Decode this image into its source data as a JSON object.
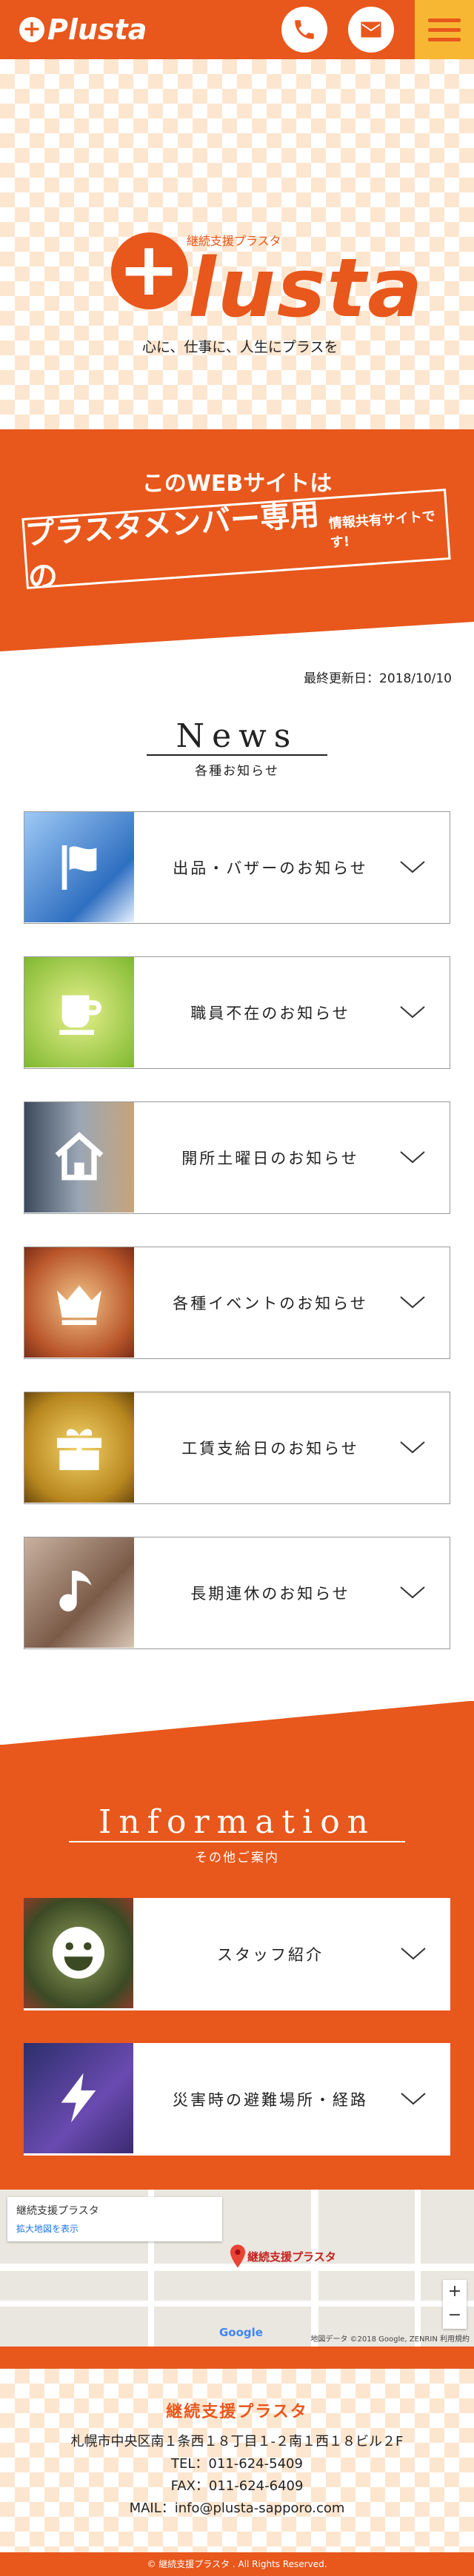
{
  "header": {
    "logo": "Plusta",
    "icons": [
      "phone-icon",
      "mail-icon",
      "menu-icon"
    ]
  },
  "hero": {
    "subtitle": "継続支援プラスタ",
    "wordmark": "lusta",
    "tagline": "心に、仕事に、人生にプラスを"
  },
  "banner": {
    "top": "このWEBサイトは",
    "main": "プラスタメンバー専用の",
    "small": "情報共有サイトです!"
  },
  "updated": "最終更新日：2018/10/10",
  "news": {
    "title": "News",
    "subtitle": "各種お知らせ",
    "items": [
      {
        "label": "出品・バザーのお知らせ",
        "icon": "flag-icon",
        "color": "#4a90d9"
      },
      {
        "label": "職員不在のお知らせ",
        "icon": "mug-icon",
        "color": "#9bc53d"
      },
      {
        "label": "開所土曜日のお知らせ",
        "icon": "house-icon",
        "color": "#6a7a8c"
      },
      {
        "label": "各種イベントのお知らせ",
        "icon": "crown-icon",
        "color": "#d9824a"
      },
      {
        "label": "工賃支給日のお知らせ",
        "icon": "gift-icon",
        "color": "#c9a227"
      },
      {
        "label": "長期連休のお知らせ",
        "icon": "music-note-icon",
        "color": "#8a6d5a"
      }
    ]
  },
  "information": {
    "title": "Information",
    "subtitle": "その他ご案内",
    "items": [
      {
        "label": "スタッフ紹介",
        "icon": "smile-icon",
        "color": "#5a6b3a"
      },
      {
        "label": "災害時の避難場所・経路",
        "icon": "lightning-icon",
        "color": "#4b3a8c"
      }
    ]
  },
  "map": {
    "place": "継続支援プラスタ",
    "link": "拡大地図を表示",
    "pin_label": "継続支援プラスタ",
    "footer": "地図データ ©2018 Google, ZENRIN 利用規約",
    "brand": "Google",
    "zoom_in": "+",
    "zoom_out": "−"
  },
  "footer": {
    "name": "継続支援プラスタ",
    "address": "札幌市中央区南１条西１８丁目１-２南１西１８ビル２F",
    "tel": "TEL：011-624-5409",
    "fax": "FAX：011-624-6409",
    "mail": "MAIL：info@plusta-sapporo.com",
    "copyright": "© 継続支援プラスタ . All Rights Reserved."
  }
}
